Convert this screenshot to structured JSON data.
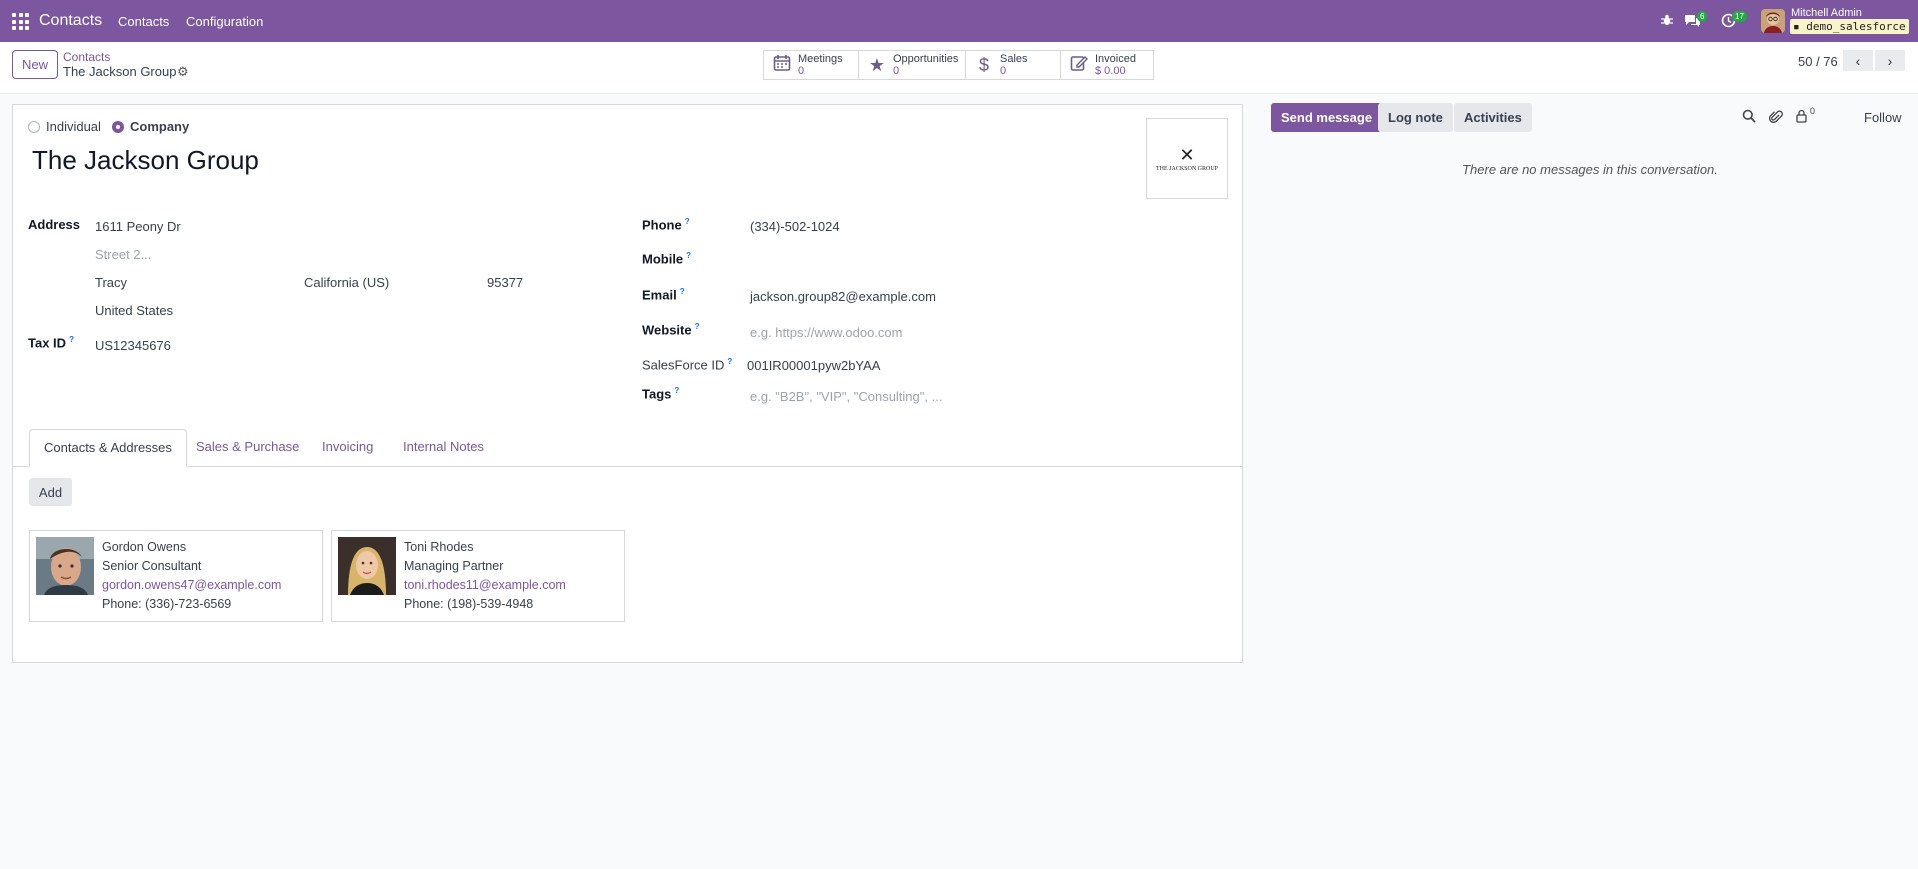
{
  "topbar": {
    "app_name": "Contacts",
    "menu": [
      "Contacts",
      "Configuration"
    ],
    "messages_badge": "6",
    "activities_badge": "17",
    "user_name": "Mitchell Admin",
    "database": "demo_salesforce"
  },
  "controlbar": {
    "new_label": "New",
    "breadcrumb_parent": "Contacts",
    "breadcrumb_current": "The Jackson Group",
    "stats": [
      {
        "label": "Meetings",
        "value": "0",
        "icon": "calendar-icon"
      },
      {
        "label": "Opportunities",
        "value": "0",
        "icon": "star-icon"
      },
      {
        "label": "Sales",
        "value": "0",
        "icon": "dollar-icon"
      },
      {
        "label": "Invoiced",
        "value": "$ 0.00",
        "icon": "edit-icon"
      }
    ],
    "pager": "50 / 76"
  },
  "form": {
    "type_individual": "Individual",
    "type_company": "Company",
    "selected_type": "Company",
    "name": "The Jackson Group",
    "logo_text": "THE JACKSON GROUP",
    "address_label": "Address",
    "street": "1611 Peony Dr",
    "street2_placeholder": "Street 2...",
    "city": "Tracy",
    "state": "California (US)",
    "zip": "95377",
    "country": "United States",
    "tax_id_label": "Tax ID",
    "tax_id": "US12345676",
    "phone_label": "Phone",
    "phone": "(334)-502-1024",
    "mobile_label": "Mobile",
    "mobile": "",
    "email_label": "Email",
    "email": "jackson.group82@example.com",
    "website_label": "Website",
    "website_placeholder": "e.g. https://www.odoo.com",
    "salesforce_label": "SalesForce ID",
    "salesforce_id": "001IR00001pyw2bYAA",
    "tags_label": "Tags",
    "tags_placeholder": "e.g. \"B2B\", \"VIP\", \"Consulting\", ..."
  },
  "tabs": [
    "Contacts & Addresses",
    "Sales & Purchase",
    "Invoicing",
    "Internal Notes"
  ],
  "add_label": "Add",
  "contacts": [
    {
      "name": "Gordon Owens",
      "title": "Senior Consultant",
      "email": "gordon.owens47@example.com",
      "phone": "Phone: (336)-723-6569"
    },
    {
      "name": "Toni Rhodes",
      "title": "Managing Partner",
      "email": "toni.rhodes11@example.com",
      "phone": "Phone: (198)-539-4948"
    }
  ],
  "chatter": {
    "send_message": "Send message",
    "log_note": "Log note",
    "activities": "Activities",
    "followers_count": "0",
    "follow": "Follow",
    "empty": "There are no messages in this conversation."
  },
  "colors": {
    "brand": "#7c569f",
    "badge": "#28a745"
  }
}
